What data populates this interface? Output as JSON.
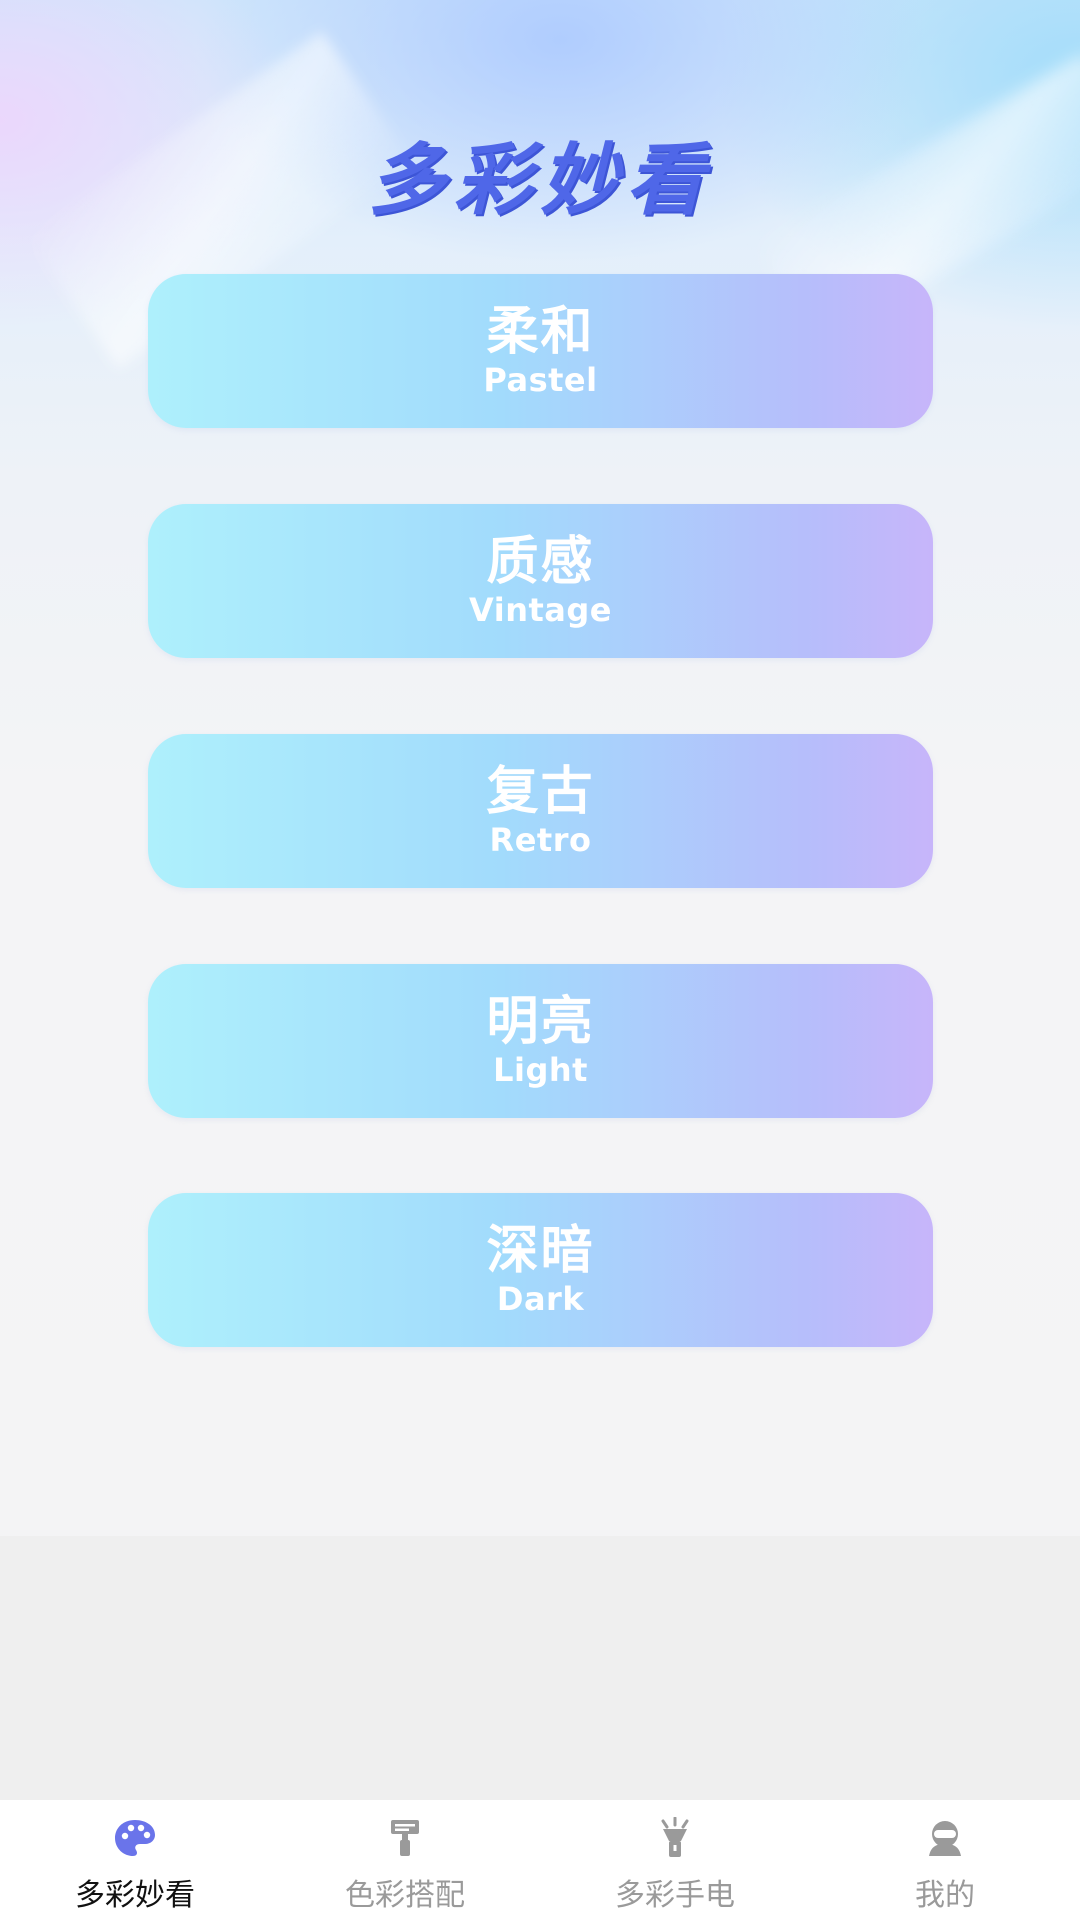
{
  "header": {
    "title": "多彩妙看"
  },
  "menu": [
    {
      "zh": "柔和",
      "en": "Pastel"
    },
    {
      "zh": "质感",
      "en": "Vintage"
    },
    {
      "zh": "复古",
      "en": "Retro"
    },
    {
      "zh": "明亮",
      "en": "Light"
    },
    {
      "zh": "深暗",
      "en": "Dark"
    }
  ],
  "tabbar": {
    "items": [
      {
        "label": "多彩妙看",
        "icon": "palette-icon",
        "active": true
      },
      {
        "label": "色彩搭配",
        "icon": "paint-roller-icon",
        "active": false
      },
      {
        "label": "多彩手电",
        "icon": "flashlight-icon",
        "active": false
      },
      {
        "label": "我的",
        "icon": "user-icon",
        "active": false
      }
    ]
  },
  "colors": {
    "title": "#4f67e8",
    "active_icon": "#6a74ea",
    "inactive": "#9a9a9a",
    "card_start": "#aef0fc",
    "card_end": "#c7b5fa"
  }
}
